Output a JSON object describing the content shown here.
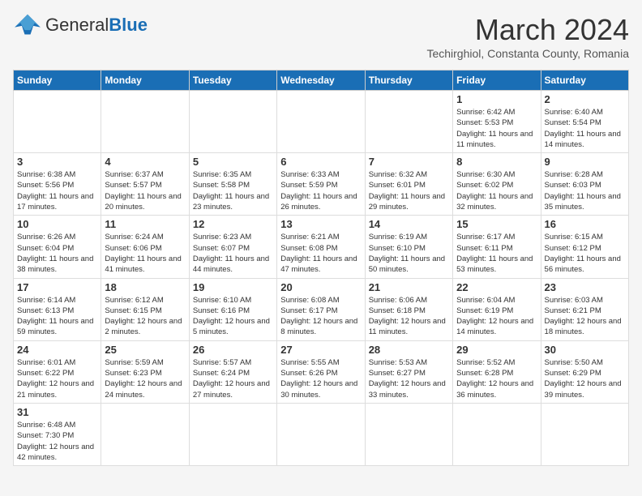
{
  "header": {
    "logo_general": "General",
    "logo_blue": "Blue",
    "month_year": "March 2024",
    "location": "Techirghiol, Constanta County, Romania"
  },
  "weekdays": [
    "Sunday",
    "Monday",
    "Tuesday",
    "Wednesday",
    "Thursday",
    "Friday",
    "Saturday"
  ],
  "weeks": [
    [
      {
        "day": "",
        "info": ""
      },
      {
        "day": "",
        "info": ""
      },
      {
        "day": "",
        "info": ""
      },
      {
        "day": "",
        "info": ""
      },
      {
        "day": "",
        "info": ""
      },
      {
        "day": "1",
        "info": "Sunrise: 6:42 AM\nSunset: 5:53 PM\nDaylight: 11 hours and 11 minutes."
      },
      {
        "day": "2",
        "info": "Sunrise: 6:40 AM\nSunset: 5:54 PM\nDaylight: 11 hours and 14 minutes."
      }
    ],
    [
      {
        "day": "3",
        "info": "Sunrise: 6:38 AM\nSunset: 5:56 PM\nDaylight: 11 hours and 17 minutes."
      },
      {
        "day": "4",
        "info": "Sunrise: 6:37 AM\nSunset: 5:57 PM\nDaylight: 11 hours and 20 minutes."
      },
      {
        "day": "5",
        "info": "Sunrise: 6:35 AM\nSunset: 5:58 PM\nDaylight: 11 hours and 23 minutes."
      },
      {
        "day": "6",
        "info": "Sunrise: 6:33 AM\nSunset: 5:59 PM\nDaylight: 11 hours and 26 minutes."
      },
      {
        "day": "7",
        "info": "Sunrise: 6:32 AM\nSunset: 6:01 PM\nDaylight: 11 hours and 29 minutes."
      },
      {
        "day": "8",
        "info": "Sunrise: 6:30 AM\nSunset: 6:02 PM\nDaylight: 11 hours and 32 minutes."
      },
      {
        "day": "9",
        "info": "Sunrise: 6:28 AM\nSunset: 6:03 PM\nDaylight: 11 hours and 35 minutes."
      }
    ],
    [
      {
        "day": "10",
        "info": "Sunrise: 6:26 AM\nSunset: 6:04 PM\nDaylight: 11 hours and 38 minutes."
      },
      {
        "day": "11",
        "info": "Sunrise: 6:24 AM\nSunset: 6:06 PM\nDaylight: 11 hours and 41 minutes."
      },
      {
        "day": "12",
        "info": "Sunrise: 6:23 AM\nSunset: 6:07 PM\nDaylight: 11 hours and 44 minutes."
      },
      {
        "day": "13",
        "info": "Sunrise: 6:21 AM\nSunset: 6:08 PM\nDaylight: 11 hours and 47 minutes."
      },
      {
        "day": "14",
        "info": "Sunrise: 6:19 AM\nSunset: 6:10 PM\nDaylight: 11 hours and 50 minutes."
      },
      {
        "day": "15",
        "info": "Sunrise: 6:17 AM\nSunset: 6:11 PM\nDaylight: 11 hours and 53 minutes."
      },
      {
        "day": "16",
        "info": "Sunrise: 6:15 AM\nSunset: 6:12 PM\nDaylight: 11 hours and 56 minutes."
      }
    ],
    [
      {
        "day": "17",
        "info": "Sunrise: 6:14 AM\nSunset: 6:13 PM\nDaylight: 11 hours and 59 minutes."
      },
      {
        "day": "18",
        "info": "Sunrise: 6:12 AM\nSunset: 6:15 PM\nDaylight: 12 hours and 2 minutes."
      },
      {
        "day": "19",
        "info": "Sunrise: 6:10 AM\nSunset: 6:16 PM\nDaylight: 12 hours and 5 minutes."
      },
      {
        "day": "20",
        "info": "Sunrise: 6:08 AM\nSunset: 6:17 PM\nDaylight: 12 hours and 8 minutes."
      },
      {
        "day": "21",
        "info": "Sunrise: 6:06 AM\nSunset: 6:18 PM\nDaylight: 12 hours and 11 minutes."
      },
      {
        "day": "22",
        "info": "Sunrise: 6:04 AM\nSunset: 6:19 PM\nDaylight: 12 hours and 14 minutes."
      },
      {
        "day": "23",
        "info": "Sunrise: 6:03 AM\nSunset: 6:21 PM\nDaylight: 12 hours and 18 minutes."
      }
    ],
    [
      {
        "day": "24",
        "info": "Sunrise: 6:01 AM\nSunset: 6:22 PM\nDaylight: 12 hours and 21 minutes."
      },
      {
        "day": "25",
        "info": "Sunrise: 5:59 AM\nSunset: 6:23 PM\nDaylight: 12 hours and 24 minutes."
      },
      {
        "day": "26",
        "info": "Sunrise: 5:57 AM\nSunset: 6:24 PM\nDaylight: 12 hours and 27 minutes."
      },
      {
        "day": "27",
        "info": "Sunrise: 5:55 AM\nSunset: 6:26 PM\nDaylight: 12 hours and 30 minutes."
      },
      {
        "day": "28",
        "info": "Sunrise: 5:53 AM\nSunset: 6:27 PM\nDaylight: 12 hours and 33 minutes."
      },
      {
        "day": "29",
        "info": "Sunrise: 5:52 AM\nSunset: 6:28 PM\nDaylight: 12 hours and 36 minutes."
      },
      {
        "day": "30",
        "info": "Sunrise: 5:50 AM\nSunset: 6:29 PM\nDaylight: 12 hours and 39 minutes."
      }
    ],
    [
      {
        "day": "31",
        "info": "Sunrise: 6:48 AM\nSunset: 7:30 PM\nDaylight: 12 hours and 42 minutes."
      },
      {
        "day": "",
        "info": ""
      },
      {
        "day": "",
        "info": ""
      },
      {
        "day": "",
        "info": ""
      },
      {
        "day": "",
        "info": ""
      },
      {
        "day": "",
        "info": ""
      },
      {
        "day": "",
        "info": ""
      }
    ]
  ]
}
